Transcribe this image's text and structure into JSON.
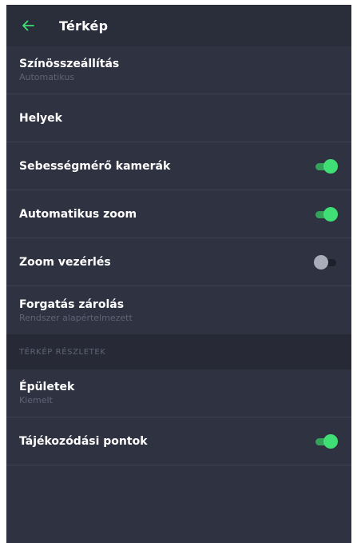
{
  "appbar": {
    "title": "Térkép",
    "back_icon": "arrow-left-icon"
  },
  "colors": {
    "accent": "#3fdf76",
    "background": "#2f3240",
    "appbar": "#2a2d3a",
    "section": "#272a36"
  },
  "settings": {
    "color_scheme": {
      "label": "Színösszeállítás",
      "value": "Automatikus"
    },
    "places": {
      "label": "Helyek"
    },
    "speed_cameras": {
      "label": "Sebességmérő kamerák",
      "enabled": true
    },
    "auto_zoom": {
      "label": "Automatikus zoom",
      "enabled": true
    },
    "zoom_control": {
      "label": "Zoom vezérlés",
      "enabled": false
    },
    "rotation_lock": {
      "label": "Forgatás zárolás",
      "value": "Rendszer alapértelmezett"
    }
  },
  "map_details": {
    "header": "TÉRKÉP RÉSZLETEK",
    "buildings": {
      "label": "Épületek",
      "value": "Kiemelt"
    },
    "landmarks": {
      "label": "Tájékozódási pontok",
      "enabled": true
    }
  }
}
